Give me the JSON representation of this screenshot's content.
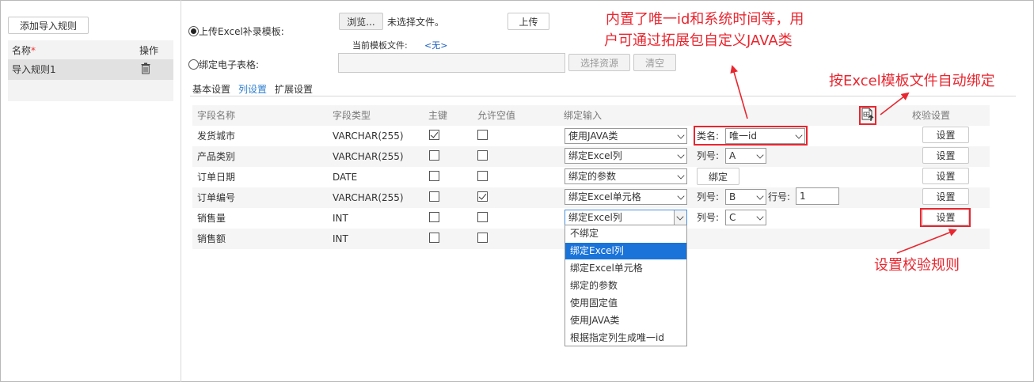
{
  "left_panel": {
    "add_rule_button": "添加导入规则",
    "list_header_name": "名称",
    "list_header_required": "*",
    "list_header_action": "操作",
    "rules": [
      {
        "name": "导入规则1",
        "action_icon": "trash-icon"
      }
    ]
  },
  "upload": {
    "radio_upload_label": "上传Excel补录模板:",
    "browse_button": "浏览...",
    "no_file_text": "未选择文件。",
    "upload_button": "上传",
    "current_template_label": "当前模板文件:",
    "current_template_value": "<无>",
    "radio_bind_label": "绑定电子表格:",
    "select_resource_button": "选择资源",
    "clear_button": "清空"
  },
  "tabs": [
    {
      "label": "基本设置"
    },
    {
      "label": "列设置"
    },
    {
      "label": "扩展设置"
    }
  ],
  "table": {
    "headers": {
      "field_name": "字段名称",
      "field_type": "字段类型",
      "primary_key": "主键",
      "allow_null": "允许空值",
      "bind_input": "绑定输入",
      "validation": "校验设置"
    },
    "auto_bind_icon": "import-excel-icon",
    "rows": [
      {
        "name": "发货城市",
        "type": "VARCHAR(255)",
        "pk": true,
        "nullable": false,
        "bind": "使用JAVA类",
        "extra_label": "类名:",
        "extra_value": "唯一id",
        "setting": "设置"
      },
      {
        "name": "产品类别",
        "type": "VARCHAR(255)",
        "pk": false,
        "nullable": false,
        "bind": "绑定Excel列",
        "extra_label": "列号:",
        "extra_value": "A",
        "setting": "设置"
      },
      {
        "name": "订单日期",
        "type": "DATE",
        "pk": false,
        "nullable": false,
        "bind": "绑定的参数",
        "extra_button": "绑定",
        "setting": "设置"
      },
      {
        "name": "订单编号",
        "type": "VARCHAR(255)",
        "pk": false,
        "nullable": true,
        "bind": "绑定Excel单元格",
        "extra_label": "列号:",
        "extra_value": "B",
        "row_label": "行号:",
        "row_value": "1",
        "setting": "设置"
      },
      {
        "name": "销售量",
        "type": "INT",
        "pk": false,
        "nullable": false,
        "bind": "绑定Excel列",
        "extra_label": "列号:",
        "extra_value": "C",
        "setting": "设置"
      },
      {
        "name": "销售额",
        "type": "INT",
        "pk": false,
        "nullable": false
      }
    ]
  },
  "dropdown_options": [
    "不绑定",
    "绑定Excel列",
    "绑定Excel单元格",
    "绑定的参数",
    "使用固定值",
    "使用JAVA类",
    "根据指定列生成唯一id"
  ],
  "dropdown_selected_index": 1,
  "annotations": {
    "java_note_line1": "内置了唯一id和系统时间等，用",
    "java_note_line2": "户可通过拓展包自定义JAVA类",
    "auto_bind_note": "按Excel模板文件自动绑定",
    "validation_note": "设置校验规则",
    "color": "#e8262f"
  }
}
